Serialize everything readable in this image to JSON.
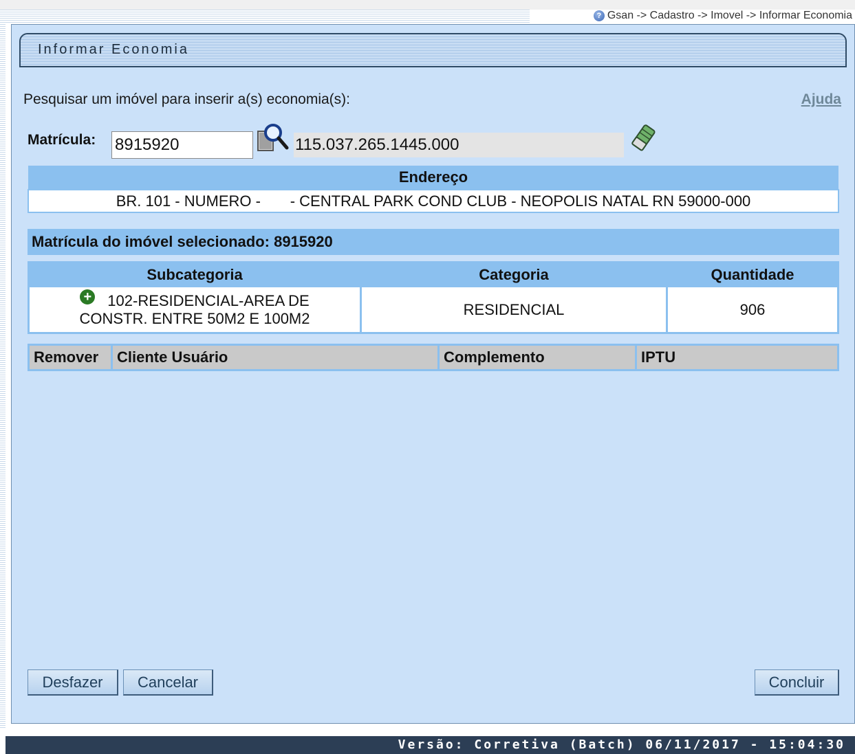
{
  "breadcrumb": "Gsan -> Cadastro -> Imovel -> Informar Economia",
  "panel": {
    "title": "Informar Economia",
    "search_label": "Pesquisar um imóvel para inserir a(s) economia(s):",
    "help_link": "Ajuda"
  },
  "matricula": {
    "label": "Matrícula:",
    "value": "8915920",
    "inscricao": "115.037.265.1445.000"
  },
  "endereco": {
    "header": "Endereço",
    "value": "BR. 101 - NUMERO -       - CENTRAL PARK COND CLUB - NEOPOLIS NATAL RN 59000-000"
  },
  "selected": {
    "label": "Matrícula do imóvel selecionado: 8915920"
  },
  "categories_table": {
    "headers": [
      "Subcategoria",
      "Categoria",
      "Quantidade"
    ],
    "rows": [
      {
        "subcategoria_line1": "102-RESIDENCIAL-AREA DE",
        "subcategoria_line2": "CONSTR. ENTRE 50M2 E 100M2",
        "categoria": "RESIDENCIAL",
        "quantidade": "906"
      }
    ]
  },
  "economias_table": {
    "headers": [
      "Remover",
      "Cliente Usuário",
      "Complemento",
      "IPTU"
    ]
  },
  "buttons": {
    "desfazer": "Desfazer",
    "cancelar": "Cancelar",
    "concluir": "Concluir"
  },
  "footer": {
    "version": "Versão: Corretiva (Batch) 06/11/2017 - 15:04:30"
  },
  "icons": {
    "help": "help-icon",
    "search": "magnifier-icon",
    "clear": "eraser-icon",
    "add": "plus-circle-icon"
  },
  "colors": {
    "panel_bg": "#cbe1f9",
    "header_blue": "#8bc0ef",
    "footer_bg": "#2c3e55",
    "add_green": "#2b7a24"
  }
}
